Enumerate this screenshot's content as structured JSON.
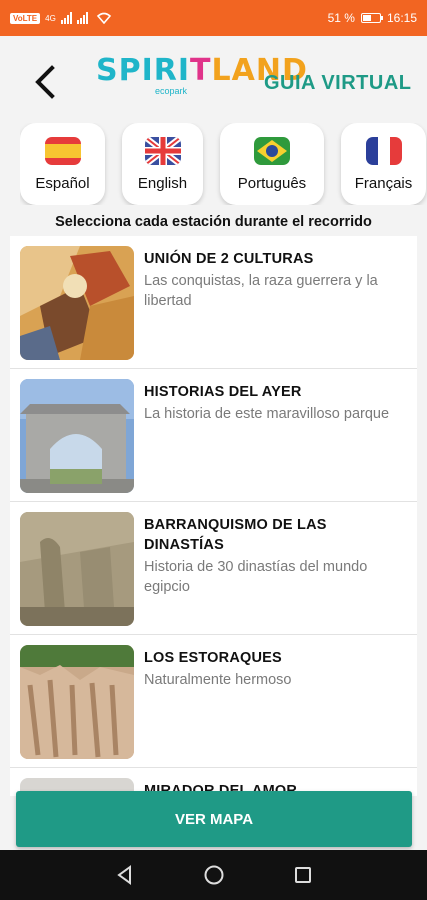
{
  "status_bar": {
    "carrier_badge": "VoLTE",
    "signal_text": "4G",
    "battery_percent": "51 %",
    "battery_level": 0.51,
    "time": "16:15"
  },
  "header": {
    "back_icon": "chevron-left-icon",
    "logo": {
      "part1": "SPIRI",
      "part2": "T",
      "part3": "LAND",
      "tagline": "ecopark"
    },
    "title": "GUIA VIRTUAL"
  },
  "languages": [
    {
      "label": "Español",
      "flag": "spain-flag-icon"
    },
    {
      "label": "English",
      "flag": "uk-flag-icon"
    },
    {
      "label": "Português",
      "flag": "brazil-flag-icon"
    },
    {
      "label": "Français",
      "flag": "france-flag-icon"
    }
  ],
  "instructions": "Selecciona cada estación durante el recorrido",
  "stations": [
    {
      "title": "UNIÓN DE 2 CULTURAS",
      "description": "Las conquistas, la raza guerrera y la libertad"
    },
    {
      "title": "HISTORIAS DEL AYER",
      "description": "La historia de este maravilloso parque"
    },
    {
      "title": "BARRANQUISMO DE LAS DINASTÍAS",
      "description": "Historia de 30 dinastías del mundo egipcio"
    },
    {
      "title": "LOS ESTORAQUES",
      "description": "Naturalmente hermoso"
    },
    {
      "title": "MIRADOR DEL AMOR",
      "description": ""
    }
  ],
  "map_button": "VER MAPA",
  "nav": {
    "back": "back-triangle-icon",
    "home": "home-circle-icon",
    "recents": "recents-square-icon"
  },
  "colors": {
    "status_bar": "#f26522",
    "accent": "#1f9a86",
    "nav_bar": "#111111"
  }
}
